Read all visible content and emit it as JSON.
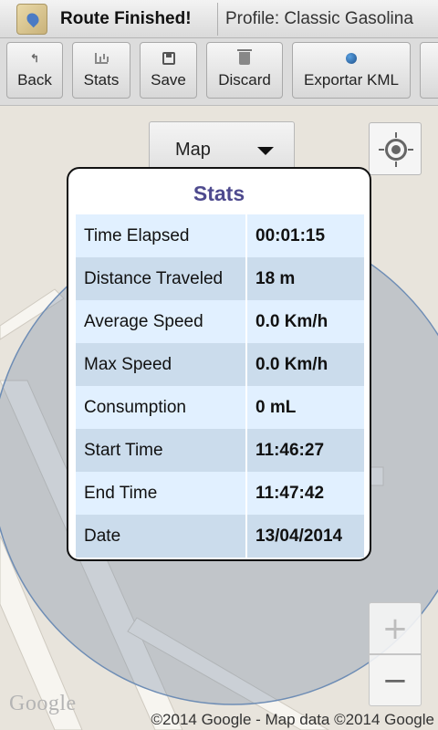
{
  "header": {
    "title": "Route Finished!",
    "profile": "Profile: Classic Gasolina"
  },
  "toolbar": {
    "back_label": "Back",
    "stats_label": "Stats",
    "save_label": "Save",
    "discard_label": "Discard",
    "export_label": "Exportar KML"
  },
  "map": {
    "dropdown_label": "Map",
    "zoom_in": "+",
    "zoom_out": "−",
    "google_logo": "Google",
    "attribution": "©2014 Google - Map data ©2014 Google"
  },
  "dialog": {
    "title": "Stats",
    "rows": [
      {
        "label": "Time Elapsed",
        "value": "00:01:15"
      },
      {
        "label": "Distance Traveled",
        "value": "18 m"
      },
      {
        "label": "Average Speed",
        "value": "0.0 Km/h"
      },
      {
        "label": "Max Speed",
        "value": "0.0 Km/h"
      },
      {
        "label": "Consumption",
        "value": "0 mL"
      },
      {
        "label": "Start Time",
        "value": "11:46:27"
      },
      {
        "label": "End Time",
        "value": "11:47:42"
      },
      {
        "label": "Date",
        "value": "13/04/2014"
      }
    ]
  },
  "colors": {
    "dialog_title": "#4e4a8e",
    "row_light": "#e1f0ff",
    "row_dark": "#cbdcec",
    "accuracy_circle": "#9fa9b4"
  },
  "icons": [
    "app-icon",
    "back-icon",
    "stats-icon",
    "save-icon",
    "discard-icon",
    "globe-icon",
    "dropdown-caret-icon",
    "locate-icon"
  ]
}
